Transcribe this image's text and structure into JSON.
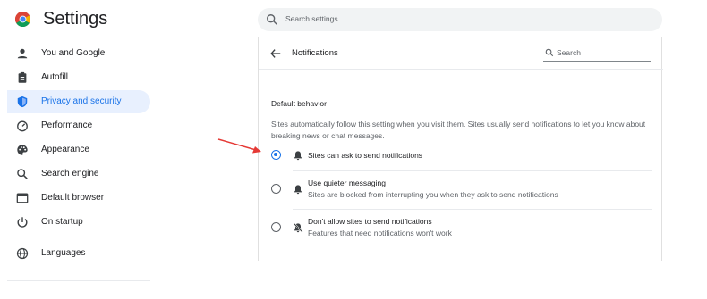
{
  "header": {
    "title": "Settings",
    "search_placeholder": "Search settings"
  },
  "sidebar": {
    "items": [
      {
        "label": "You and Google",
        "icon": "person-icon",
        "active": false
      },
      {
        "label": "Autofill",
        "icon": "clipboard-icon",
        "active": false
      },
      {
        "label": "Privacy and security",
        "icon": "shield-icon",
        "active": true
      },
      {
        "label": "Performance",
        "icon": "speedometer-icon",
        "active": false
      },
      {
        "label": "Appearance",
        "icon": "palette-icon",
        "active": false
      },
      {
        "label": "Search engine",
        "icon": "search-icon",
        "active": false
      },
      {
        "label": "Default browser",
        "icon": "browser-window-icon",
        "active": false
      },
      {
        "label": "On startup",
        "icon": "power-icon",
        "active": false
      },
      {
        "label": "Languages",
        "icon": "globe-icon",
        "active": false
      }
    ]
  },
  "main": {
    "page_title": "Notifications",
    "search_placeholder": "Search",
    "section_label": "Default behavior",
    "description": "Sites automatically follow this setting when you visit them. Sites usually send notifications to let you know about breaking news or chat messages.",
    "options": [
      {
        "title": "Sites can ask to send notifications",
        "subtitle": "",
        "selected": true,
        "icon": "bell-icon"
      },
      {
        "title": "Use quieter messaging",
        "subtitle": "Sites are blocked from interrupting you when they ask to send notifications",
        "selected": false,
        "icon": "bell-icon"
      },
      {
        "title": "Don't allow sites to send notifications",
        "subtitle": "Features that need notifications won't work",
        "selected": false,
        "icon": "bell-off-icon"
      }
    ]
  },
  "colors": {
    "accent": "#1a73e8",
    "active_bg": "#e8f0fe",
    "annotation": "#e53935"
  }
}
